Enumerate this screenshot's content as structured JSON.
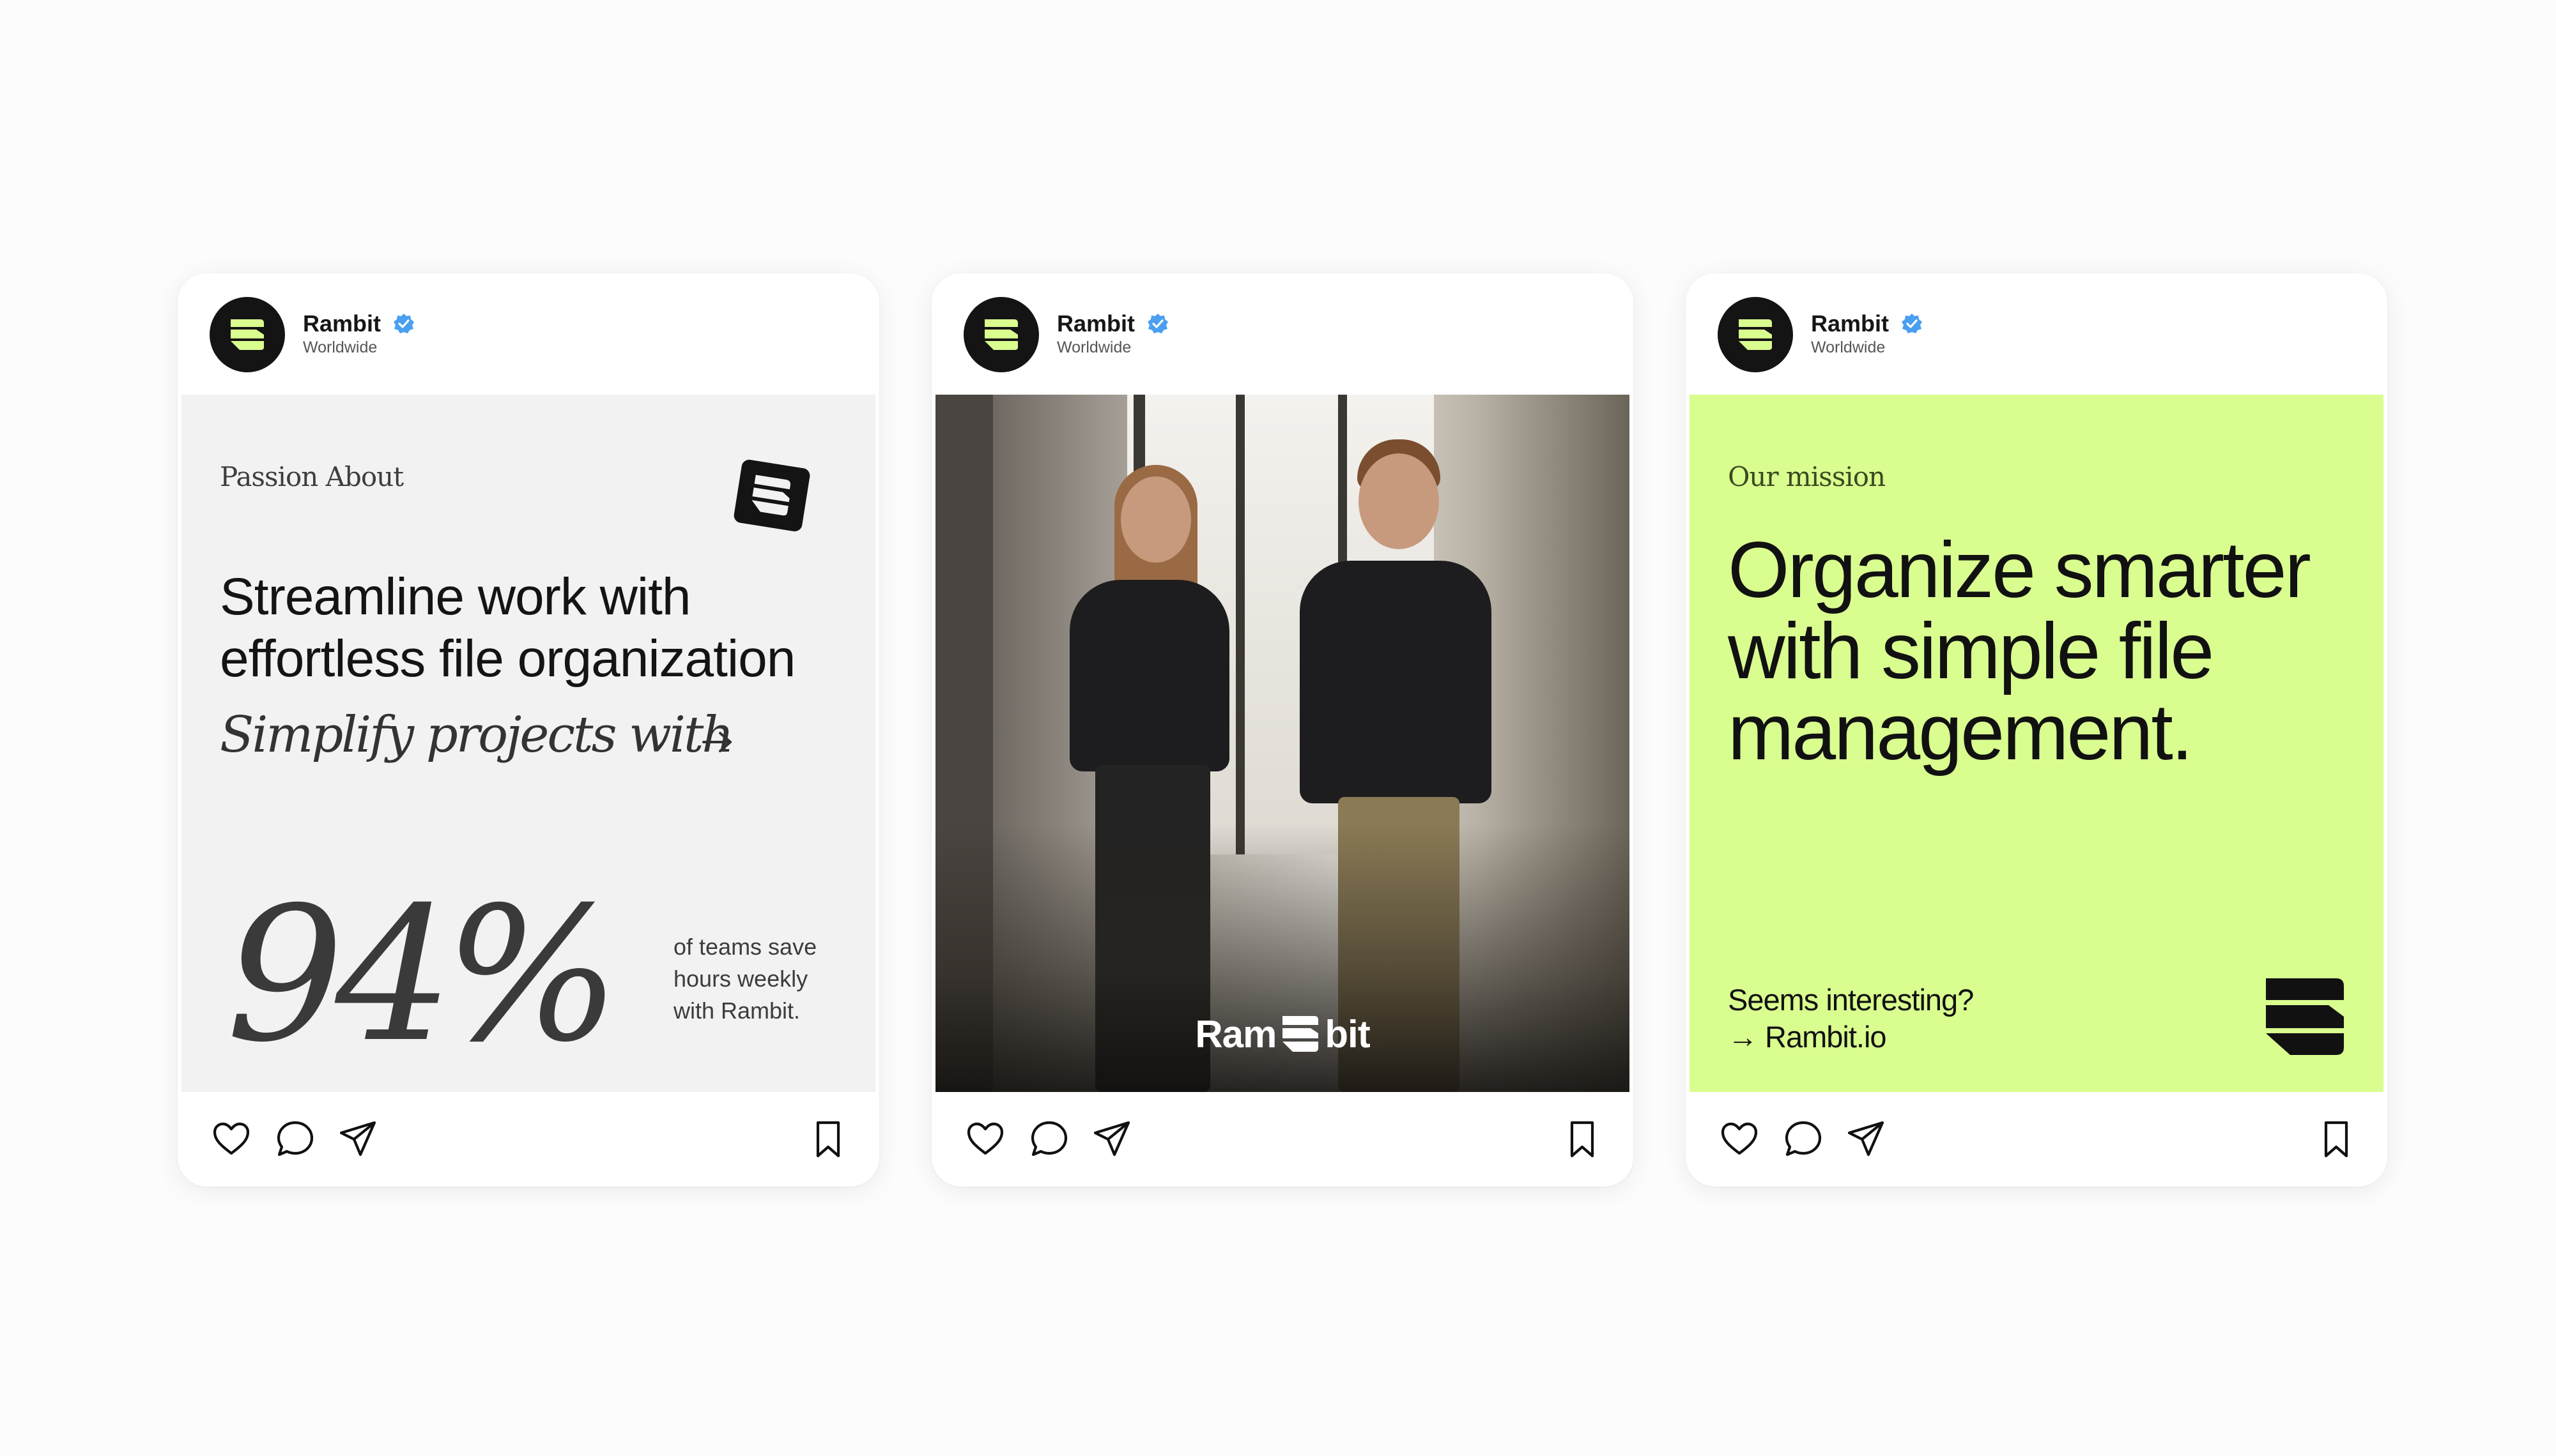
{
  "brand": {
    "accent": "#d9fd8f",
    "dark": "#141414",
    "verified_color": "#4a9ff0"
  },
  "icons": {
    "avatar": "rambit-logo-icon",
    "verified": "verified-badge-icon",
    "actions": [
      "heart-icon",
      "comment-icon",
      "send-icon",
      "bookmark-icon"
    ]
  },
  "posts": [
    {
      "account": {
        "name": "Rambit",
        "location": "Worldwide"
      },
      "eyebrow": "Passion About",
      "headline": "Streamline work with effortless file organization",
      "subhead": "Simplify projects with",
      "stat": "94%",
      "stat_desc_line1": "of teams save",
      "stat_desc_line2": "hours weekly",
      "stat_desc_line3": "with Rambit."
    },
    {
      "account": {
        "name": "Rambit",
        "location": "Worldwide"
      },
      "wordmark_left": "Ram",
      "wordmark_right": "bit"
    },
    {
      "account": {
        "name": "Rambit",
        "location": "Worldwide"
      },
      "eyebrow": "Our mission",
      "headline_line1": "Organize smarter",
      "headline_line2": "with simple file",
      "headline_line3": "management.",
      "cta_question": "Seems interesting?",
      "cta_link": "→ Rambit.io"
    }
  ]
}
